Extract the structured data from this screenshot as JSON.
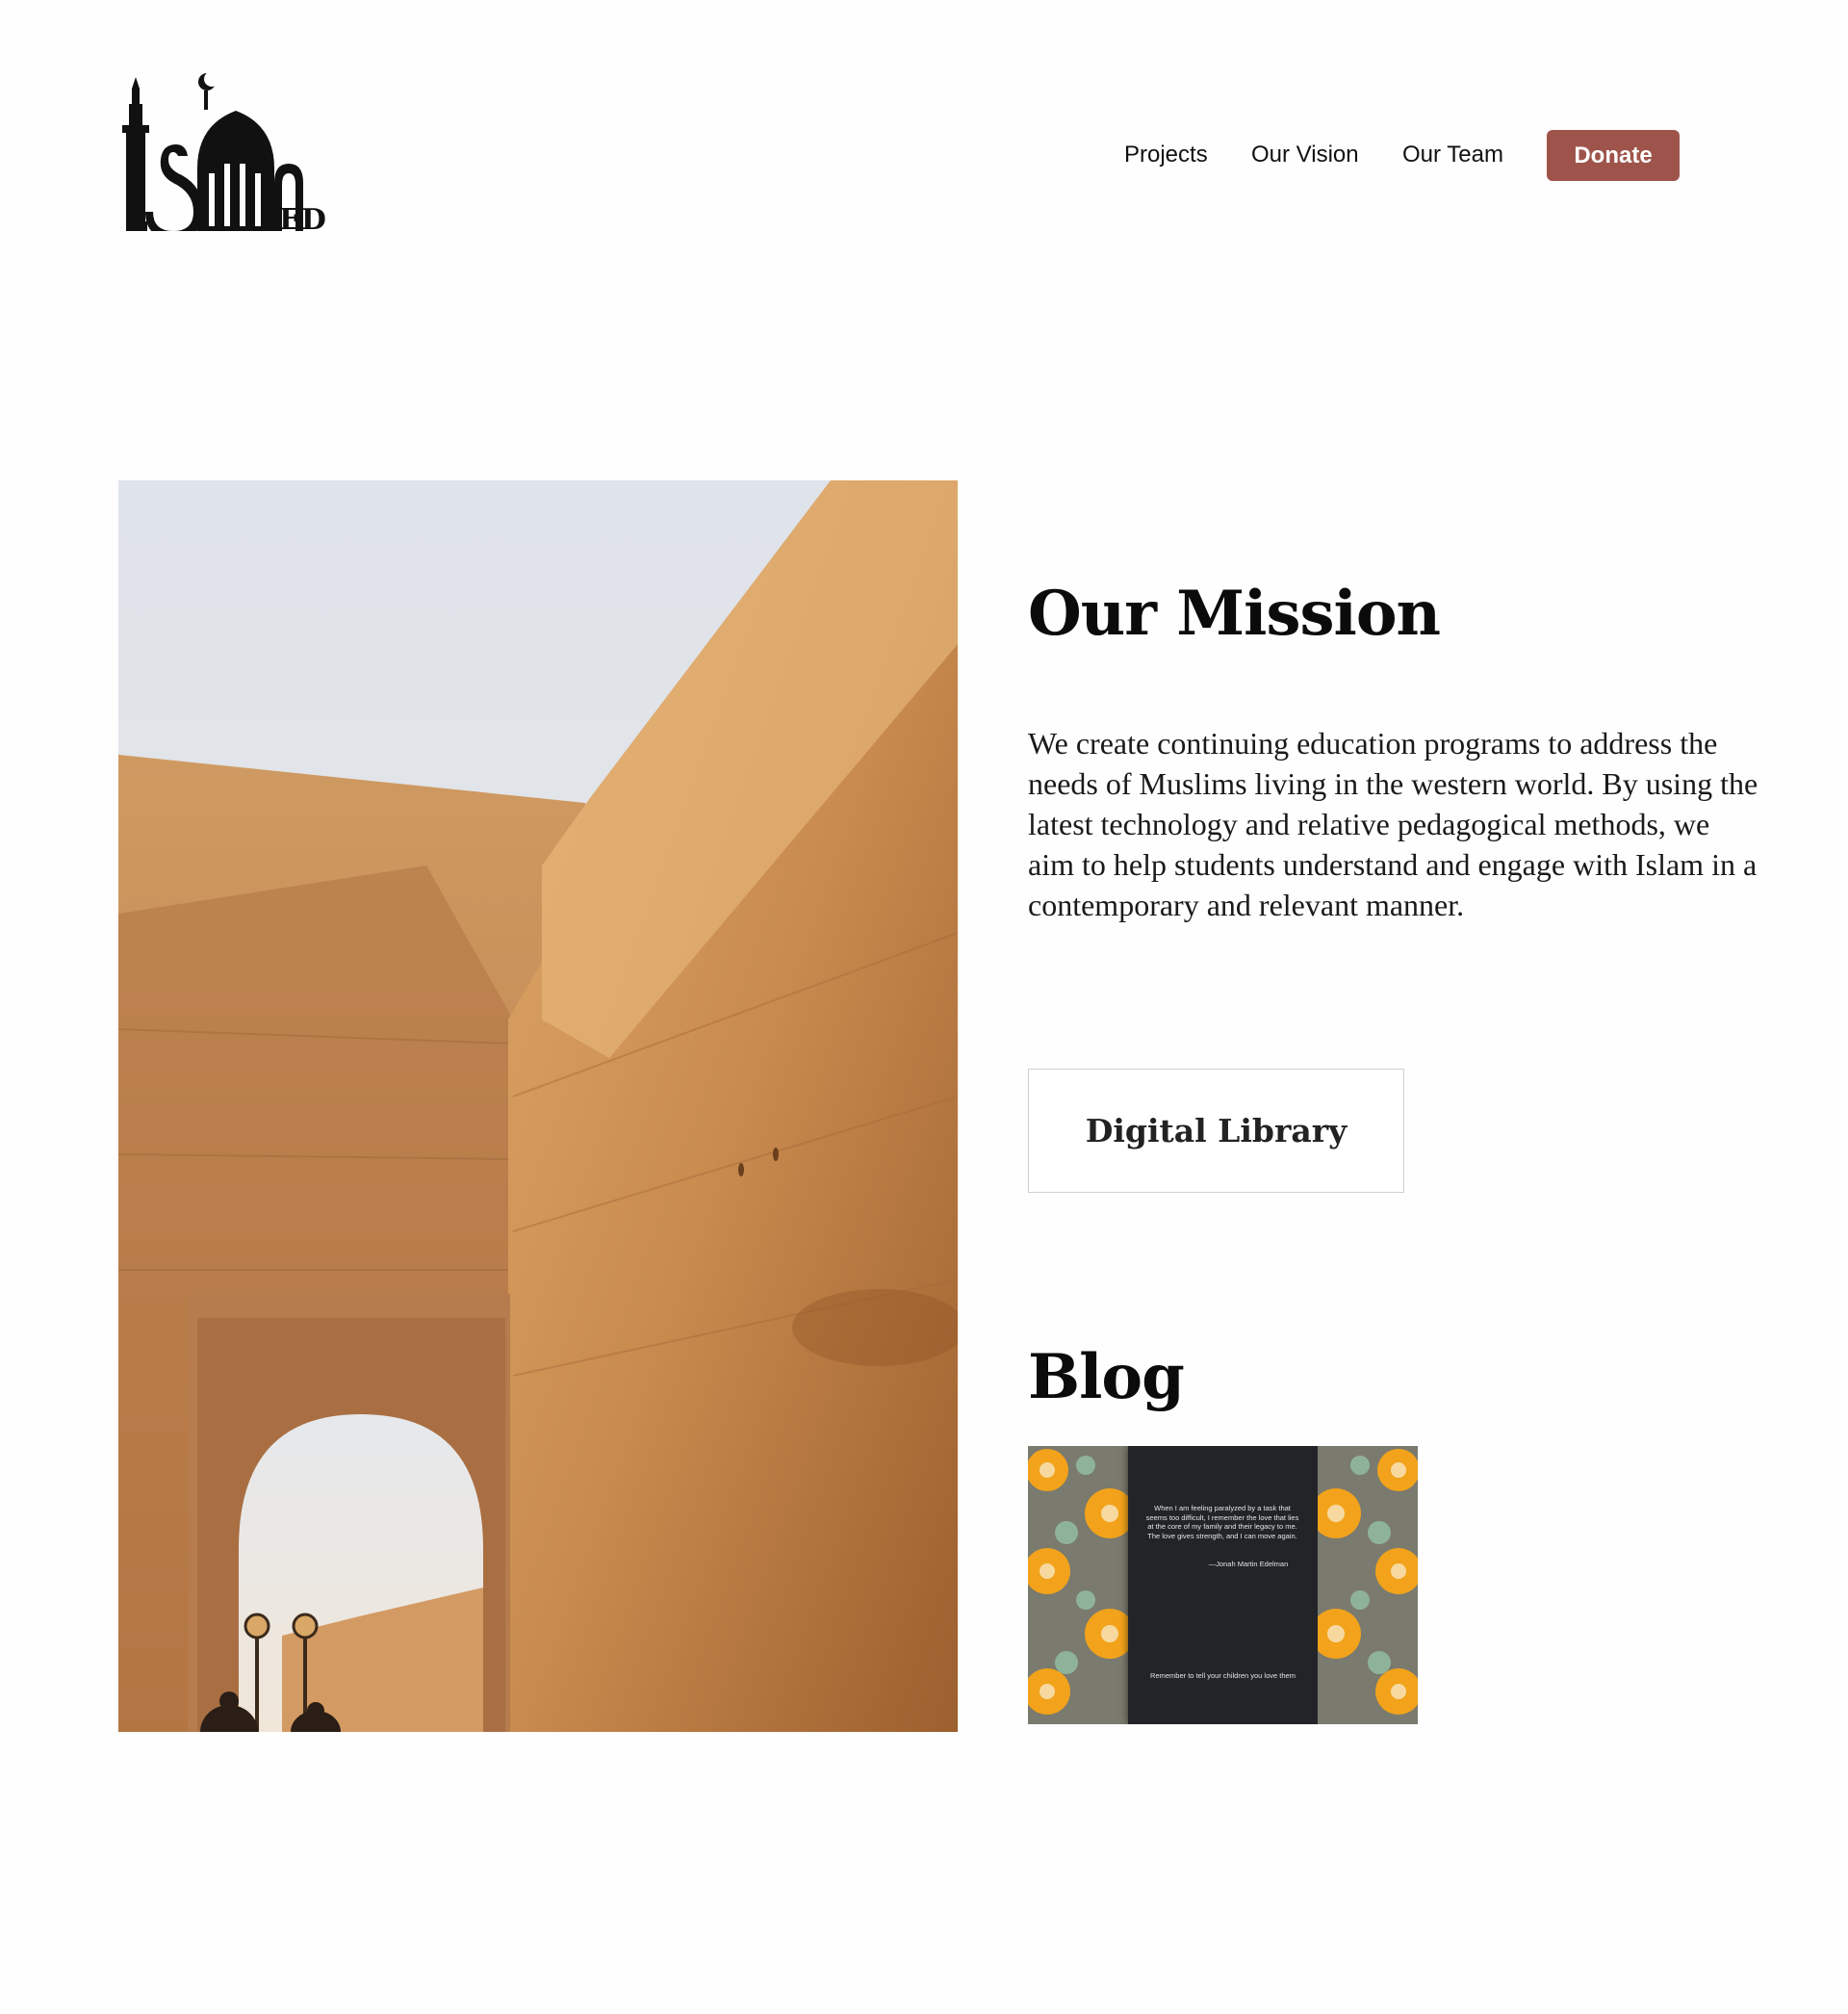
{
  "header": {
    "logo": {
      "text": "IslamED",
      "icon": "mosque-logo-icon"
    },
    "nav": {
      "projects": "Projects",
      "vision": "Our Vision",
      "team": "Our Team",
      "donate": "Donate"
    }
  },
  "hero": {
    "icon": "arched-alley-photo"
  },
  "mission": {
    "title": "Our Mission",
    "text": "We create continuing education programs to address the needs of Muslims living in the western world. By using the latest technology and relative pedagogical methods, we aim to help students understand and engage with Islam in a contemporary and relevant manner."
  },
  "library": {
    "label": "Digital Library"
  },
  "blog": {
    "title": "Blog",
    "card": {
      "quote": "When I am feeling paralyzed by a task that seems too difficult, I remember the love that lies at the core of my family and their legacy to me. The love gives strength, and I can move again.",
      "author": "—Jonah Martin Edelman",
      "caption": "Remember to tell your children you love them"
    }
  },
  "colors": {
    "donate_bg": "#9e544b",
    "pattern_orange": "#f2a31b",
    "pattern_sage": "#8fb39a",
    "card_dark": "#222427"
  }
}
